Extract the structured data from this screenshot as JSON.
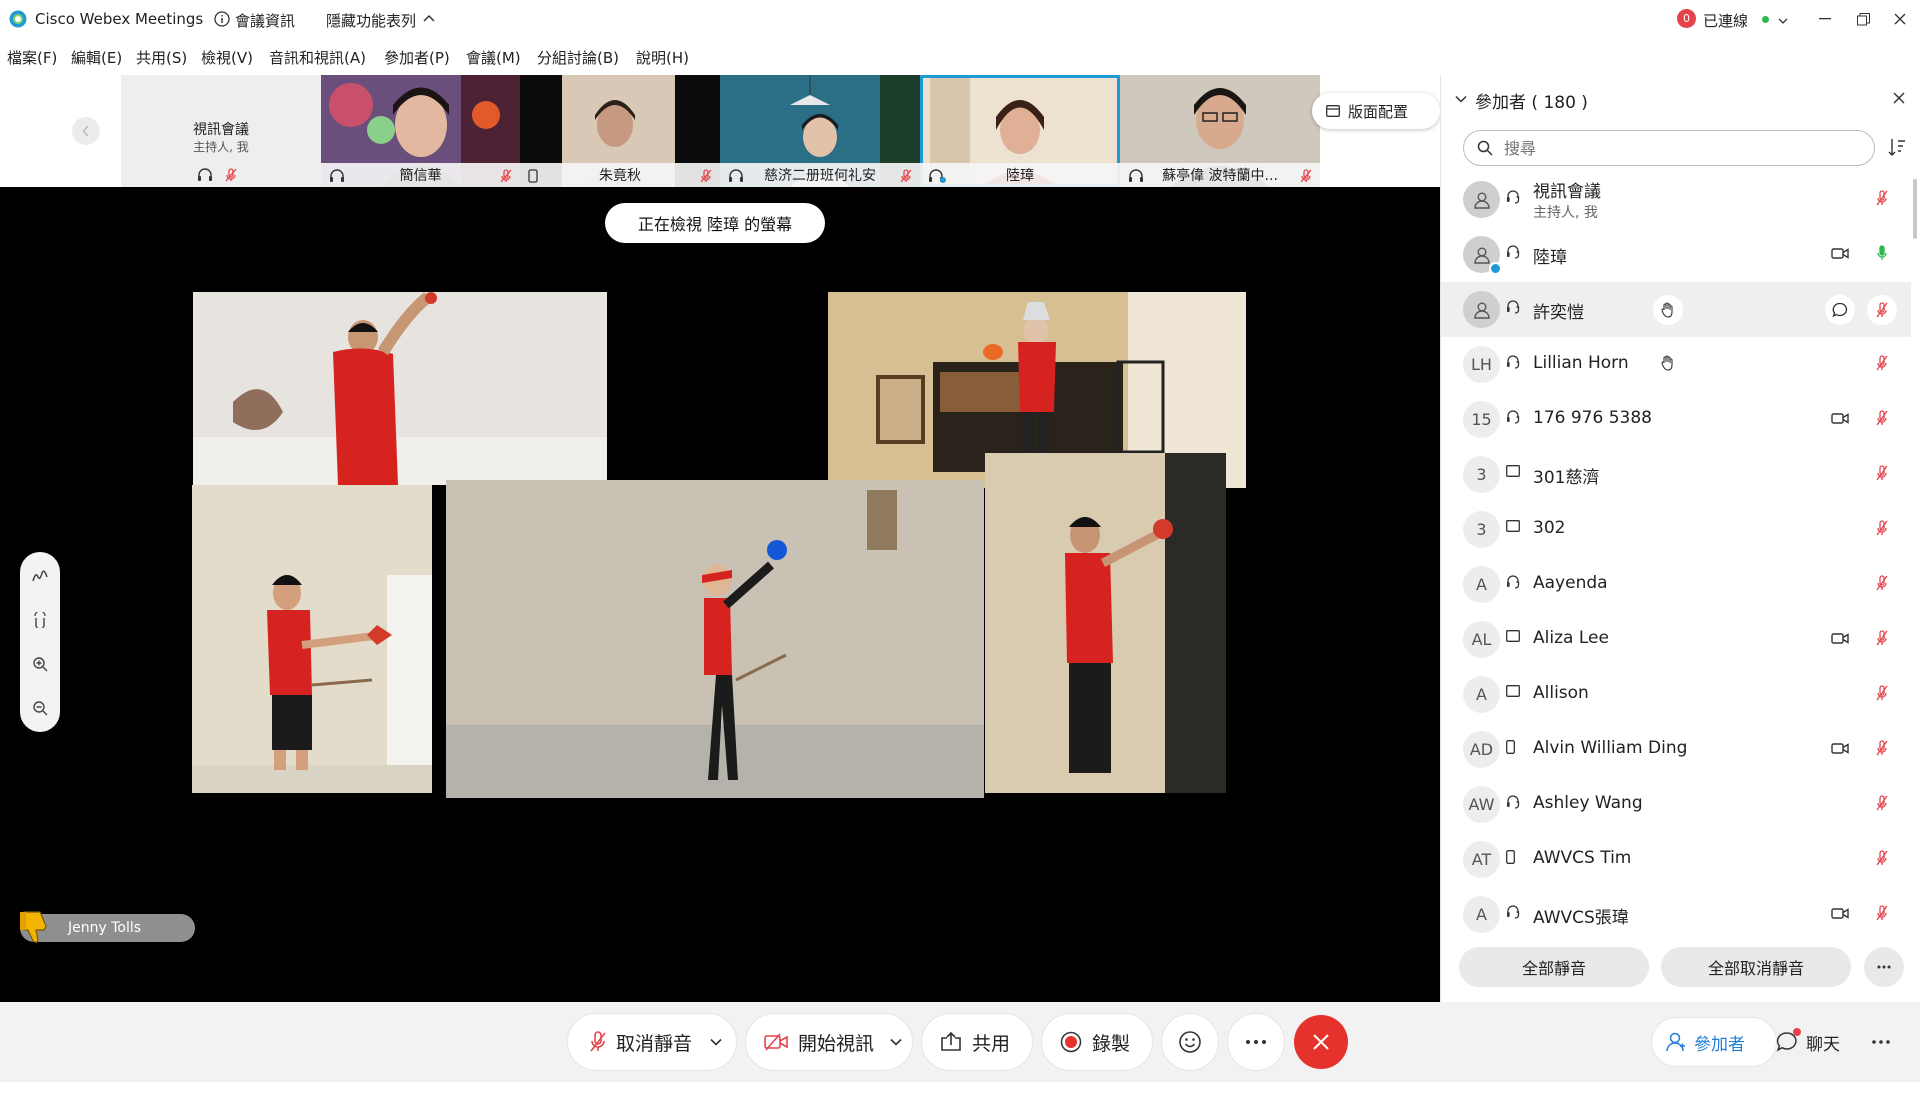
{
  "titlebar": {
    "app_title": "Cisco Webex Meetings",
    "meeting_info": "會議資訊",
    "hide_menu": "隱藏功能表列",
    "notification_count": "0",
    "connection_status": "已連線"
  },
  "menu": [
    "檔案(F)",
    "編輯(E)",
    "共用(S)",
    "檢視(V)",
    "音訊和視訊(A)",
    "參加者(P)",
    "會議(M)",
    "分組討論(B)",
    "說明(H)"
  ],
  "filmstrip": {
    "host_tile": {
      "name": "視訊會議",
      "sub": "主持人, 我"
    },
    "tiles": [
      "簡信華",
      "朱竟秋",
      "慈济二册班何礼安",
      "陸璋",
      "蘇亭偉 波特蘭中..."
    ],
    "layout_button": "版面配置"
  },
  "stage": {
    "viewing_label": "正在檢視 陸璋 的螢幕",
    "reaction_name": "Jenny Tolls"
  },
  "controls": {
    "unmute": "取消靜音",
    "start_video": "開始視訊",
    "share": "共用",
    "record": "錄製"
  },
  "panel": {
    "title": "參加者 ( 180 )",
    "search_placeholder": "搜尋",
    "participants": [
      {
        "initials": "",
        "name": "視訊會議",
        "sub": "主持人, 我",
        "conn": "audio",
        "video": false,
        "hand": false,
        "chat": false,
        "mic": "muted"
      },
      {
        "initials": "",
        "name": "陸璋",
        "sub": "",
        "conn": "audio",
        "video": true,
        "hand": false,
        "chat": false,
        "mic": "active"
      },
      {
        "initials": "",
        "name": "許奕愷",
        "sub": "",
        "conn": "audio",
        "video": false,
        "hand": true,
        "chat": true,
        "mic": "muted"
      },
      {
        "initials": "LH",
        "name": "Lillian Horn",
        "sub": "",
        "conn": "audio",
        "video": false,
        "hand": true,
        "chat": false,
        "mic": "muted"
      },
      {
        "initials": "15",
        "name": "176 976 5388",
        "sub": "",
        "conn": "audio",
        "video": true,
        "hand": false,
        "chat": false,
        "mic": "muted"
      },
      {
        "initials": "3",
        "name": "301慈濟",
        "sub": "",
        "conn": "screen",
        "video": false,
        "hand": false,
        "chat": false,
        "mic": "muted"
      },
      {
        "initials": "3",
        "name": "302",
        "sub": "",
        "conn": "screen",
        "video": false,
        "hand": false,
        "chat": false,
        "mic": "muted"
      },
      {
        "initials": "A",
        "name": "Aayenda",
        "sub": "",
        "conn": "audio",
        "video": false,
        "hand": false,
        "chat": false,
        "mic": "muted"
      },
      {
        "initials": "AL",
        "name": "Aliza Lee",
        "sub": "",
        "conn": "screen",
        "video": true,
        "hand": false,
        "chat": false,
        "mic": "muted"
      },
      {
        "initials": "A",
        "name": "Allison",
        "sub": "",
        "conn": "screen",
        "video": false,
        "hand": false,
        "chat": false,
        "mic": "muted"
      },
      {
        "initials": "AD",
        "name": "Alvin William Ding",
        "sub": "",
        "conn": "phone",
        "video": true,
        "hand": false,
        "chat": false,
        "mic": "muted"
      },
      {
        "initials": "AW",
        "name": "Ashley Wang",
        "sub": "",
        "conn": "audio",
        "video": false,
        "hand": false,
        "chat": false,
        "mic": "muted"
      },
      {
        "initials": "AT",
        "name": "AWVCS Tim",
        "sub": "",
        "conn": "phone",
        "video": false,
        "hand": false,
        "chat": false,
        "mic": "muted"
      },
      {
        "initials": "A",
        "name": "AWVCS張瑋",
        "sub": "",
        "conn": "audio",
        "video": true,
        "hand": false,
        "chat": false,
        "mic": "muted"
      }
    ],
    "mute_all": "全部靜音",
    "unmute_all": "全部取消靜音"
  },
  "bottom_right": {
    "participants_tab": "參加者",
    "chat_tab": "聊天"
  },
  "colors": {
    "accent": "#1f9ad6",
    "mute_red": "#e5434b",
    "end_red": "#e6322d",
    "mic_green": "#2db74c"
  }
}
